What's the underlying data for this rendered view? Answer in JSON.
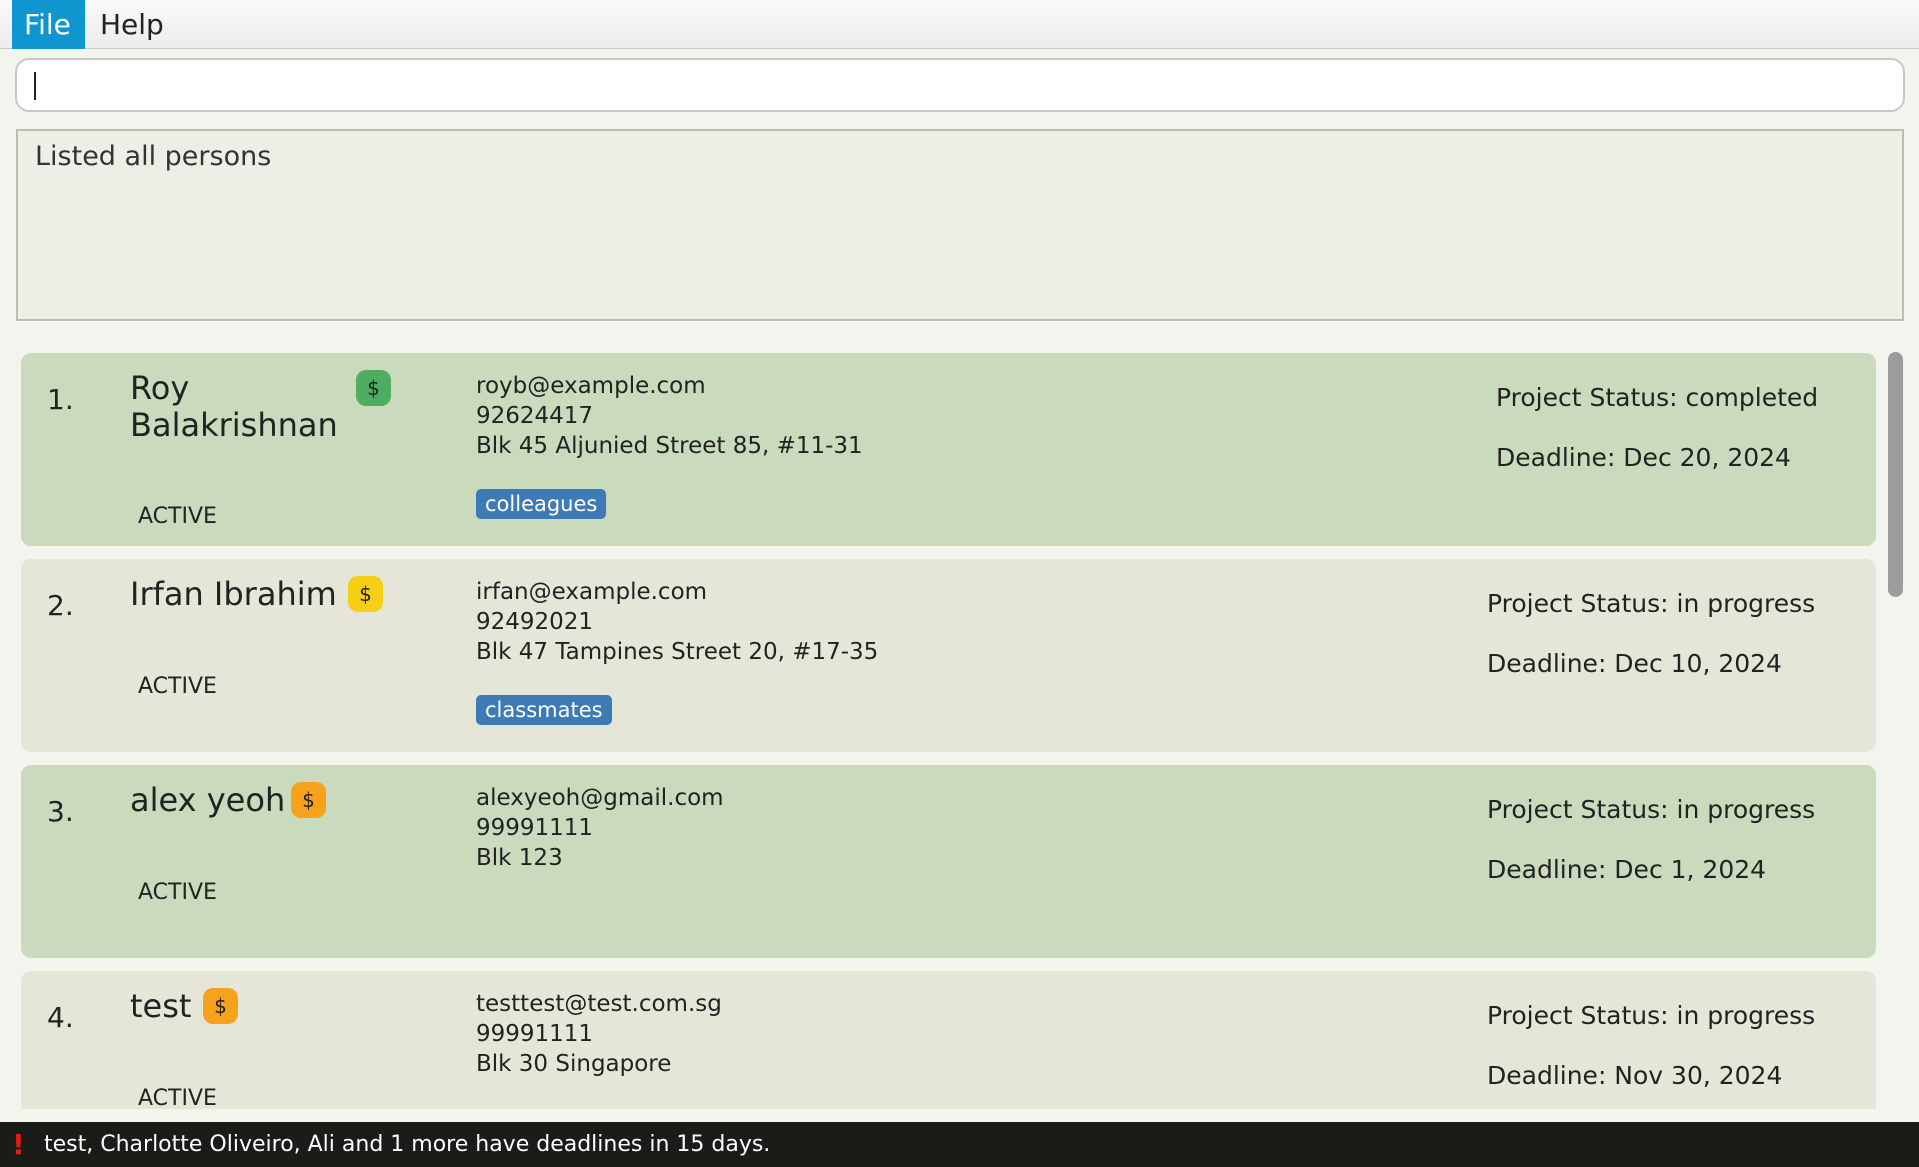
{
  "menu": {
    "file_label": "File",
    "help_label": "Help"
  },
  "command": {
    "value": ""
  },
  "result": {
    "text": "Listed all persons"
  },
  "persons": [
    {
      "index": "1.",
      "name": "Roy Balakrishnan",
      "badge": "$",
      "badge_color": "#4fad62",
      "state": "ACTIVE",
      "email": "royb@example.com",
      "phone": "92624417",
      "address": "Blk 45 Aljunied Street 85, #11-31",
      "tag": "colleagues",
      "project_status": "Project Status: completed",
      "deadline": "Deadline: Dec 20, 2024"
    },
    {
      "index": "2.",
      "name": "Irfan Ibrahim",
      "badge": "$",
      "badge_color": "#f6ce16",
      "state": "ACTIVE",
      "email": "irfan@example.com",
      "phone": "92492021",
      "address": "Blk 47 Tampines Street 20, #17-35",
      "tag": "classmates",
      "project_status": "Project Status: in progress",
      "deadline": "Deadline: Dec 10, 2024"
    },
    {
      "index": "3.",
      "name": "alex yeoh",
      "badge": "$",
      "badge_color": "#f6a21c",
      "state": "ACTIVE",
      "email": "alexyeoh@gmail.com",
      "phone": "99991111",
      "address": "Blk 123",
      "project_status": "Project Status: in progress",
      "deadline": "Deadline: Dec 1, 2024"
    },
    {
      "index": "4.",
      "name": "test",
      "badge": "$",
      "badge_color": "#f6a21c",
      "state": "ACTIVE",
      "email": "testtest@test.com.sg",
      "phone": "99991111",
      "address": "Blk 30 Singapore",
      "project_status": "Project Status: in progress",
      "deadline": "Deadline: Nov 30, 2024"
    }
  ],
  "statusbar": {
    "icon": "exclamation-icon",
    "text": "test, Charlotte Oliveiro, Ali and 1 more have deadlines in 15 days."
  }
}
